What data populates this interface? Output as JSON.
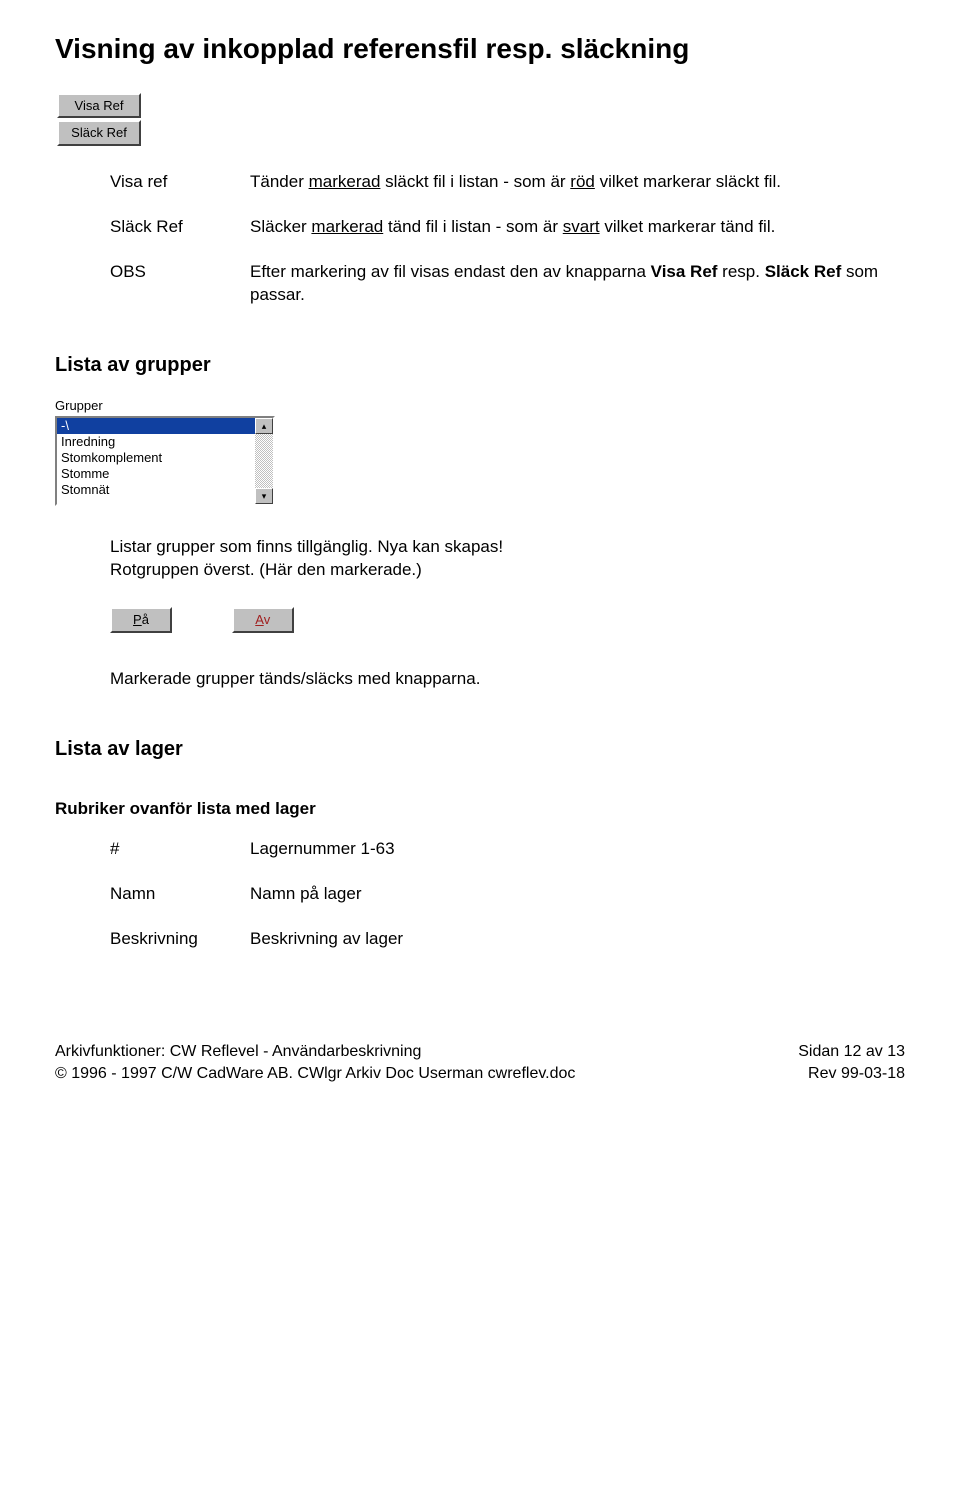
{
  "title": "Visning  av inkopplad referensfil resp. släckning",
  "buttons": {
    "visa_ref": "Visa Ref",
    "slack_ref": "Släck Ref",
    "pa_u": "P",
    "pa_rest": "å",
    "av_u": "A",
    "av_rest": "v"
  },
  "defs": {
    "visa_ref": {
      "term": "Visa ref",
      "pre": "Tänder ",
      "u": "markerad",
      "mid": " släckt fil i listan - som är ",
      "u2": "röd",
      "post": " vilket markerar släckt fil."
    },
    "slack_ref": {
      "term": "Släck Ref",
      "pre": "Släcker ",
      "u": "markerad",
      "mid": " tänd fil i listan - som är ",
      "u2": "svart",
      "post": " vilket markerar tänd fil."
    },
    "obs": {
      "term": "OBS",
      "desc_pre": "Efter markering av fil visas endast den av knapparna ",
      "b1": "Visa Ref",
      "mid": " resp. ",
      "b2": "Släck Ref",
      "post": " som passar."
    }
  },
  "grupper": {
    "heading": "Lista av grupper",
    "label": "Grupper",
    "items": [
      "-\\",
      "Inredning",
      "Stomkomplement",
      "Stomme",
      "Stomnät"
    ],
    "note1": "Listar grupper som finns tillgänglig. Nya kan skapas!",
    "note2": "Rotgruppen överst. (Här den markerade.)",
    "note3": "Markerade grupper tänds/släcks med knapparna."
  },
  "lager": {
    "heading": "Lista av lager",
    "subheading": "Rubriker ovanför lista med lager",
    "rows": [
      {
        "k": "#",
        "v": "Lagernummer 1-63"
      },
      {
        "k": "Namn",
        "v": "Namn på lager"
      },
      {
        "k": "Beskrivning",
        "v": "Beskrivning av lager"
      }
    ]
  },
  "footer": {
    "l1": "Arkivfunktioner: CW Reflevel - Användarbeskrivning",
    "l2": "© 1996 - 1997 C/W CadWare AB. CWlgr Arkiv Doc Userman cwreflev.doc",
    "r1": "Sidan 12 av 13",
    "r2": "Rev 99-03-18"
  }
}
